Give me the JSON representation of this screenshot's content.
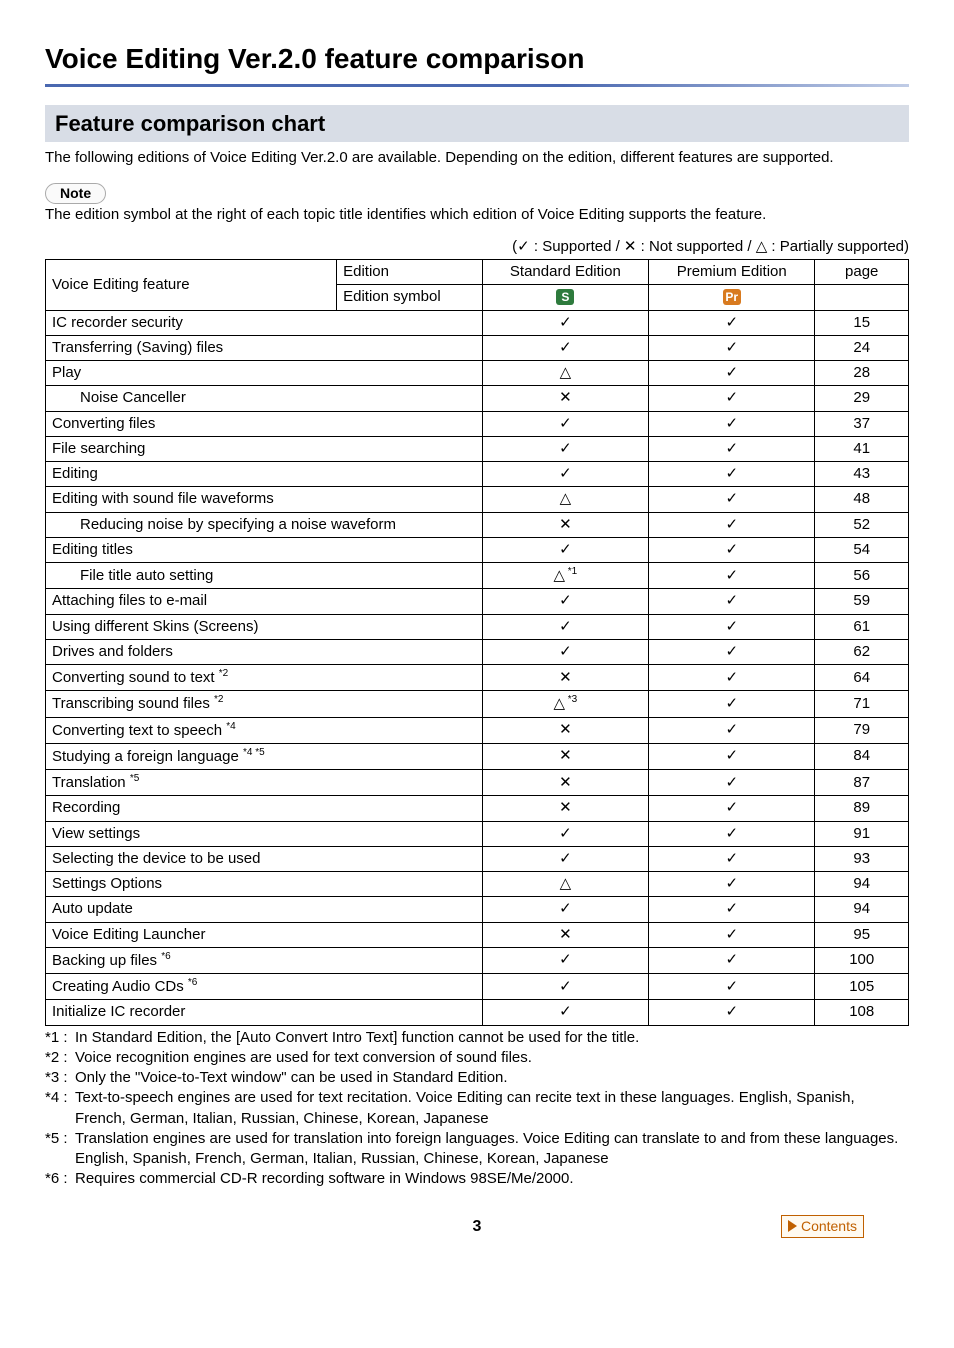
{
  "page_title": "Voice Editing Ver.2.0 feature comparison",
  "section_title": "Feature comparison chart",
  "intro": "The following editions of Voice Editing Ver.2.0 are available. Depending on the edition, different features are supported.",
  "note_label": "Note",
  "note_text": "The edition symbol at the right of each topic title identifies which edition of Voice Editing supports the feature.",
  "legend": "(✓ : Supported / ✕ : Not supported / △ : Partially supported)",
  "headers": {
    "feature": "Voice Editing feature",
    "edition": "Edition",
    "symbol": "Edition symbol",
    "standard": "Standard Edition",
    "premium": "Premium Edition",
    "page": "page",
    "badge_s": "S",
    "badge_pr": "Pr"
  },
  "chart_data": {
    "type": "table",
    "columns": [
      "feature",
      "standard",
      "premium",
      "page"
    ],
    "rows": [
      {
        "feature": "IC recorder security",
        "std": "✓",
        "pre": "✓",
        "page": "15",
        "indent": 0
      },
      {
        "feature": "Transferring (Saving) files",
        "std": "✓",
        "pre": "✓",
        "page": "24",
        "indent": 0
      },
      {
        "feature": "Play",
        "std": "△",
        "pre": "✓",
        "page": "28",
        "indent": 0
      },
      {
        "feature": "Noise Canceller",
        "std": "✕",
        "pre": "✓",
        "page": "29",
        "indent": 1
      },
      {
        "feature": "Converting files",
        "std": "✓",
        "pre": "✓",
        "page": "37",
        "indent": 0
      },
      {
        "feature": "File searching",
        "std": "✓",
        "pre": "✓",
        "page": "41",
        "indent": 0
      },
      {
        "feature": "Editing",
        "std": "✓",
        "pre": "✓",
        "page": "43",
        "indent": 0
      },
      {
        "feature": "Editing with sound file waveforms",
        "std": "△",
        "pre": "✓",
        "page": "48",
        "indent": 0
      },
      {
        "feature": "Reducing noise by specifying a noise waveform",
        "std": "✕",
        "pre": "✓",
        "page": "52",
        "indent": 1
      },
      {
        "feature": "Editing titles",
        "std": "✓",
        "pre": "✓",
        "page": "54",
        "indent": 0
      },
      {
        "feature": "File title auto setting",
        "std": "△",
        "std_sup": "*1",
        "pre": "✓",
        "page": "56",
        "indent": 1
      },
      {
        "feature": "Attaching files to e-mail",
        "std": "✓",
        "pre": "✓",
        "page": "59",
        "indent": 0
      },
      {
        "feature": "Using different Skins (Screens)",
        "std": "✓",
        "pre": "✓",
        "page": "61",
        "indent": 0
      },
      {
        "feature": "Drives and folders",
        "std": "✓",
        "pre": "✓",
        "page": "62",
        "indent": 0
      },
      {
        "feature": "Converting sound to text ",
        "feat_sup": "*2",
        "std": "✕",
        "pre": "✓",
        "page": "64",
        "indent": 0
      },
      {
        "feature": "Transcribing sound files ",
        "feat_sup": "*2",
        "std": "△",
        "std_sup": "*3",
        "pre": "✓",
        "page": "71",
        "indent": 0
      },
      {
        "feature": "Converting text to speech ",
        "feat_sup": "*4",
        "std": "✕",
        "pre": "✓",
        "page": "79",
        "indent": 0
      },
      {
        "feature": "Studying a foreign language ",
        "feat_sup": "*4 *5",
        "std": "✕",
        "pre": "✓",
        "page": "84",
        "indent": 0
      },
      {
        "feature": "Translation ",
        "feat_sup": "*5",
        "std": "✕",
        "pre": "✓",
        "page": "87",
        "indent": 0
      },
      {
        "feature": "Recording",
        "std": "✕",
        "pre": "✓",
        "page": "89",
        "indent": 0
      },
      {
        "feature": "View settings",
        "std": "✓",
        "pre": "✓",
        "page": "91",
        "indent": 0
      },
      {
        "feature": "Selecting the device to be used",
        "std": "✓",
        "pre": "✓",
        "page": "93",
        "indent": 0
      },
      {
        "feature": "Settings Options",
        "std": "△",
        "pre": "✓",
        "page": "94",
        "indent": 0
      },
      {
        "feature": "Auto update",
        "std": "✓",
        "pre": "✓",
        "page": "94",
        "indent": 0
      },
      {
        "feature": "Voice Editing Launcher",
        "std": "✕",
        "pre": "✓",
        "page": "95",
        "indent": 0
      },
      {
        "feature": "Backing up files ",
        "feat_sup": "*6",
        "std": "✓",
        "pre": "✓",
        "page": "100",
        "indent": 0
      },
      {
        "feature": "Creating Audio CDs ",
        "feat_sup": "*6",
        "std": "✓",
        "pre": "✓",
        "page": "105",
        "indent": 0
      },
      {
        "feature": "Initialize IC recorder",
        "std": "✓",
        "pre": "✓",
        "page": "108",
        "indent": 0
      }
    ]
  },
  "footnotes": [
    {
      "k": "*1 :",
      "t": "In Standard Edition, the [Auto Convert Intro Text] function cannot be used for the title."
    },
    {
      "k": "*2 :",
      "t": "Voice recognition engines are used for text conversion of sound files."
    },
    {
      "k": "*3 :",
      "t": "Only the \"Voice-to-Text window\" can be used in Standard Edition."
    },
    {
      "k": "*4 :",
      "t": "Text-to-speech engines are used for text recitation. Voice Editing can recite text in these languages. English, Spanish, French, German, Italian, Russian, Chinese, Korean, Japanese"
    },
    {
      "k": "*5 :",
      "t": "Translation engines are used for translation into foreign languages. Voice Editing can translate to and from these languages.\nEnglish, Spanish, French, German, Italian, Russian, Chinese, Korean, Japanese"
    },
    {
      "k": "*6 :",
      "t": "Requires commercial CD-R recording software in Windows 98SE/Me/2000."
    }
  ],
  "page_number": "3",
  "contents_label": "Contents"
}
